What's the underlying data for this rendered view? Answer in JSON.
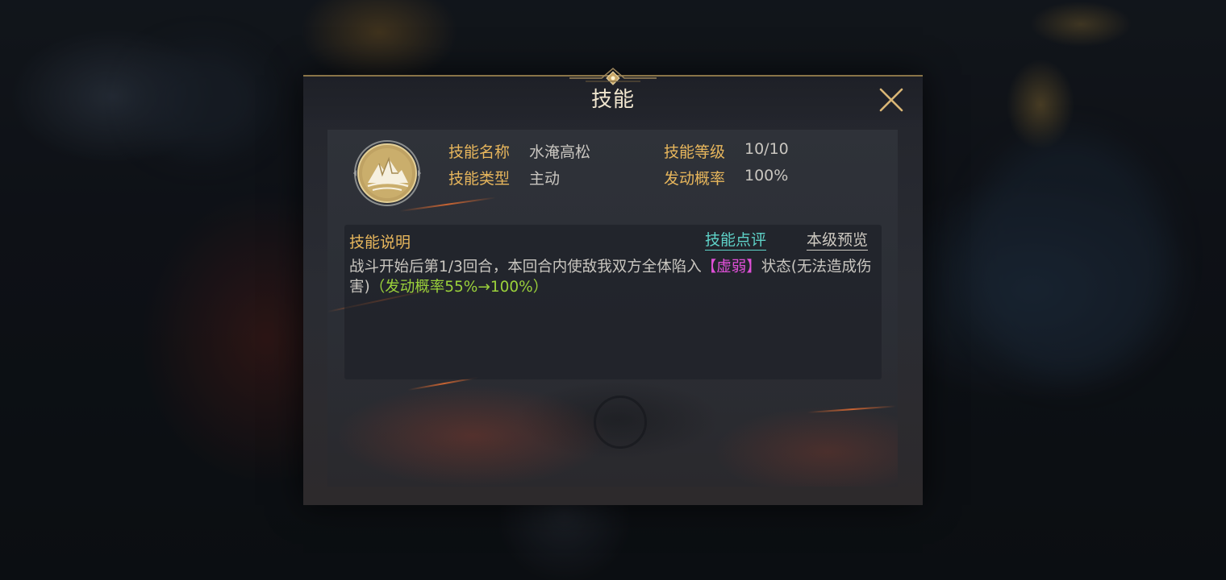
{
  "dialog": {
    "title": "技能",
    "close_icon": "close-x-icon"
  },
  "skill": {
    "icon": "snow-mountain-skill-icon",
    "name_label": "技能名称",
    "name_value": "水淹高松",
    "level_label": "技能等级",
    "level_value": "10/10",
    "type_label": "技能类型",
    "type_value": "主动",
    "chance_label": "发动概率",
    "chance_value": "100%"
  },
  "description": {
    "title": "技能说明",
    "review_link": "技能点评",
    "preview_link": "本级预览",
    "text_part1": "战斗开始后第1/3回合，本回合内使敌我双方全体陷入",
    "status_effect": "【虚弱】",
    "text_part2": "状态(无法造成伤害)",
    "rate_note": "（发动概率55%→100%）"
  },
  "colors": {
    "label_gold": "#e7b65c",
    "link_cyan": "#5fd3c9",
    "status_magenta": "#e050d8",
    "rate_green": "#9bd13b"
  }
}
